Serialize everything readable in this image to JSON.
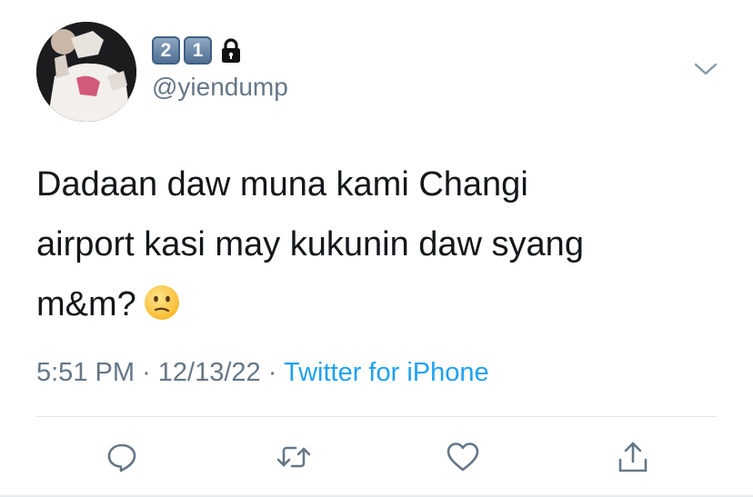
{
  "tweet": {
    "display_name_keycaps": [
      "2",
      "1"
    ],
    "handle": "@yiendump",
    "text_lines": [
      "Dadaan daw muna kami Changi",
      "airport kasi may kukunin daw syang",
      "m&m?"
    ],
    "time": "5:51 PM",
    "separator": "·",
    "date": "12/13/22",
    "source": "Twitter for iPhone"
  },
  "icons": {
    "lock": "lock-icon",
    "menu": "chevron-down-icon",
    "emoji": "confused-face-emoji",
    "reply": "reply-icon",
    "retweet": "retweet-icon",
    "like": "heart-icon",
    "share": "share-icon"
  },
  "colors": {
    "text": "#14171a",
    "secondary": "#657786",
    "link": "#1da1f2",
    "keycap": "#5a7ba0"
  }
}
